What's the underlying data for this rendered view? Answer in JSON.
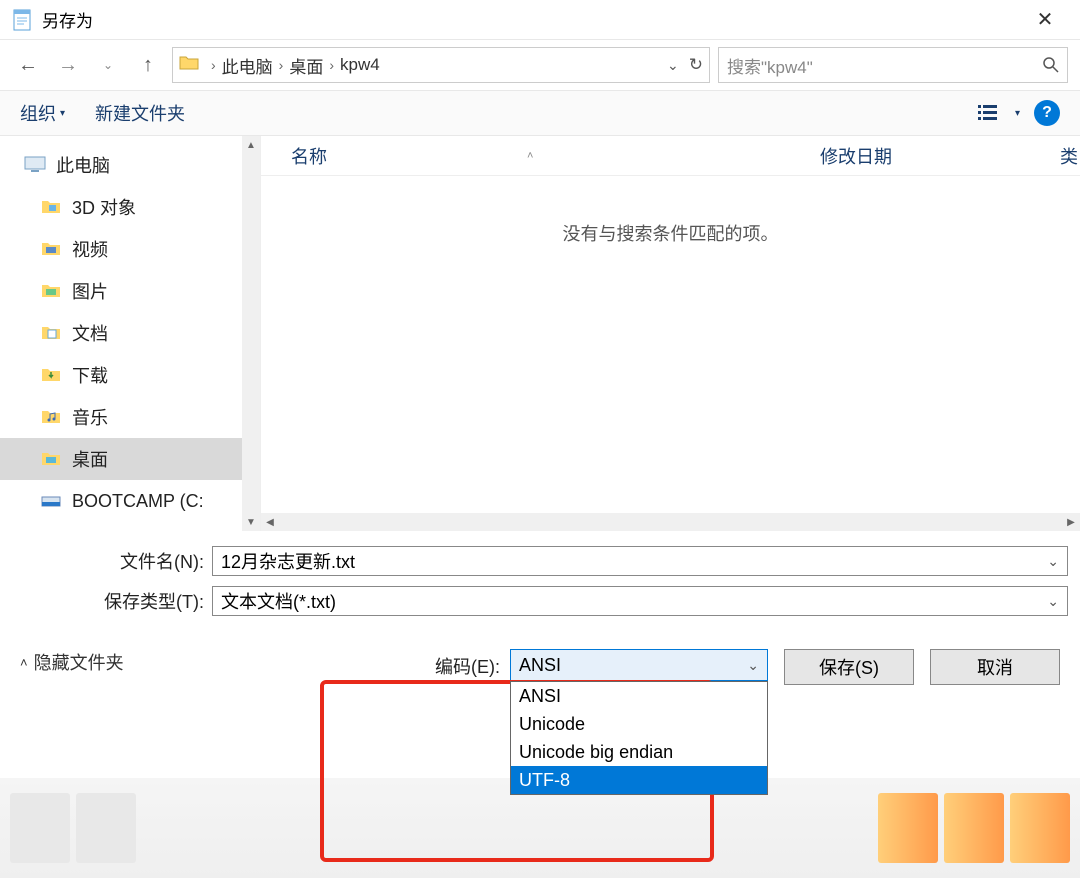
{
  "window": {
    "title": "另存为"
  },
  "nav": {
    "breadcrumb": {
      "pc": "此电脑",
      "desktop": "桌面",
      "folder": "kpw4"
    },
    "search_placeholder": "搜索\"kpw4\""
  },
  "toolbar": {
    "organize": "组织",
    "new_folder": "新建文件夹"
  },
  "sidebar": {
    "items": [
      {
        "label": "此电脑"
      },
      {
        "label": "3D 对象"
      },
      {
        "label": "视频"
      },
      {
        "label": "图片"
      },
      {
        "label": "文档"
      },
      {
        "label": "下载"
      },
      {
        "label": "音乐"
      },
      {
        "label": "桌面"
      },
      {
        "label": "BOOTCAMP (C:"
      }
    ]
  },
  "filepane": {
    "col_name": "名称",
    "col_date": "修改日期",
    "col_type": "类",
    "empty_msg": "没有与搜索条件匹配的项。"
  },
  "form": {
    "filename_label": "文件名(N):",
    "filename_value": "12月杂志更新.txt",
    "filetype_label": "保存类型(T):",
    "filetype_value": "文本文档(*.txt)"
  },
  "footer": {
    "hide_folders": "隐藏文件夹",
    "encoding_label": "编码(E):",
    "encoding_value": "ANSI",
    "encoding_options": [
      "ANSI",
      "Unicode",
      "Unicode big endian",
      "UTF-8"
    ],
    "save": "保存(S)",
    "cancel": "取消"
  }
}
